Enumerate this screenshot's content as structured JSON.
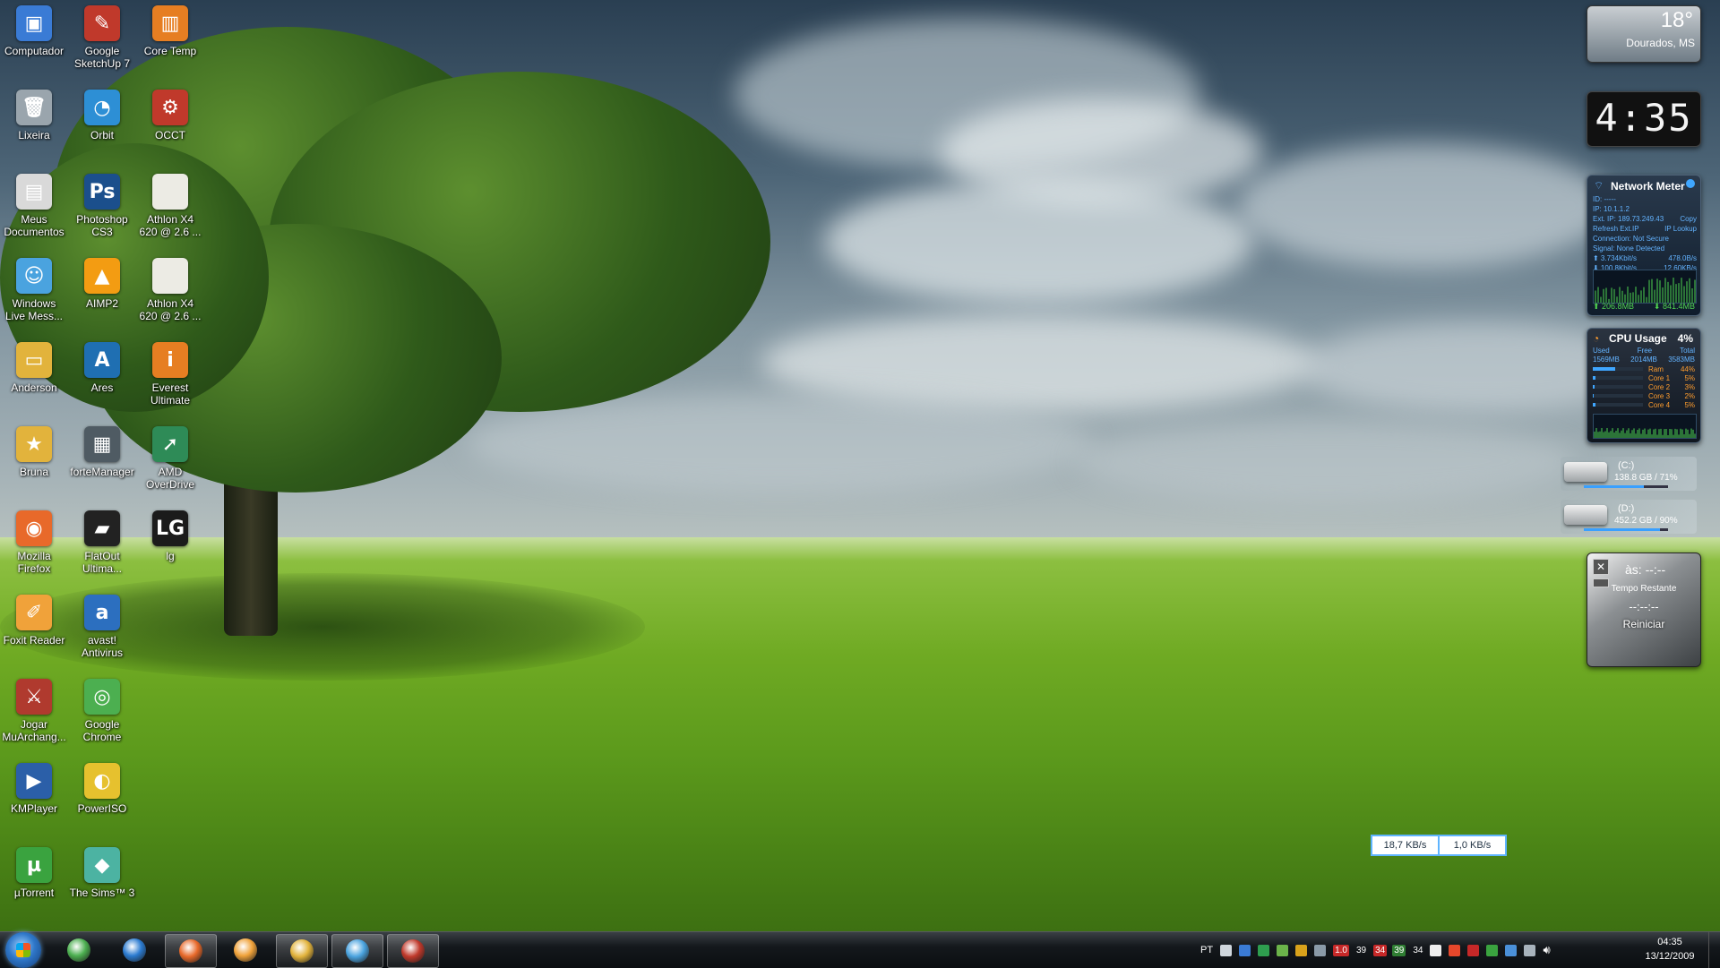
{
  "desktop": {
    "icons": [
      {
        "label": "Computador",
        "color": "#3a7bd5",
        "glyph": "▣"
      },
      {
        "label": "Google\nSketchUp 7",
        "color": "#c0392b",
        "glyph": "✎"
      },
      {
        "label": "Core Temp",
        "color": "#e67e22",
        "glyph": "▥"
      },
      {
        "label": "Lixeira",
        "color": "#9aa5ad",
        "glyph": "🗑"
      },
      {
        "label": "Orbit",
        "color": "#2d8fd5",
        "glyph": "◔"
      },
      {
        "label": "OCCT",
        "color": "#c0392b",
        "glyph": "⚙"
      },
      {
        "label": "Meus\nDocumentos",
        "color": "#d9d9d9",
        "glyph": "▤"
      },
      {
        "label": "Photoshop\nCS3",
        "color": "#1b4f8c",
        "glyph": "Ps"
      },
      {
        "label": "Athlon X4\n620 @ 2.6 ...",
        "color": "#ecebe4",
        "glyph": ""
      },
      {
        "label": "Windows\nLive Mess...",
        "color": "#4aa3df",
        "glyph": "☺"
      },
      {
        "label": "AIMP2",
        "color": "#f39c12",
        "glyph": "▲"
      },
      {
        "label": "Athlon X4\n620 @ 2.6 ...",
        "color": "#ecebe4",
        "glyph": ""
      },
      {
        "label": "Anderson",
        "color": "#e2b33c",
        "glyph": "▭"
      },
      {
        "label": "Ares",
        "color": "#1f6fb2",
        "glyph": "A"
      },
      {
        "label": "Everest\nUltimate",
        "color": "#e67e22",
        "glyph": "i"
      },
      {
        "label": "Bruna",
        "color": "#e2b33c",
        "glyph": "★"
      },
      {
        "label": "forteManager",
        "color": "#4f5b63",
        "glyph": "▦"
      },
      {
        "label": "AMD\nOverDrive",
        "color": "#2e8b57",
        "glyph": "➚"
      },
      {
        "label": "Mozilla\nFirefox",
        "color": "#e8692a",
        "glyph": "◉"
      },
      {
        "label": "FlatOut\nUltima...",
        "color": "#222222",
        "glyph": "▰"
      },
      {
        "label": "lg",
        "color": "#1b1b1b",
        "glyph": "LG"
      },
      {
        "label": "Foxit Reader",
        "color": "#f0a23a",
        "glyph": "✐"
      },
      {
        "label": "avast!\nAntivirus",
        "color": "#2c6fbf",
        "glyph": "a"
      },
      {
        "label": "Jogar\nMuArchang...",
        "color": "#b03a2e",
        "glyph": "⚔"
      },
      {
        "label": "Google\nChrome",
        "color": "#4caf50",
        "glyph": "◎"
      },
      {
        "label": "KMPlayer",
        "color": "#2b5fa8",
        "glyph": "▶"
      },
      {
        "label": "PowerISO",
        "color": "#e6c12e",
        "glyph": "◐"
      },
      {
        "label": "µTorrent",
        "color": "#3aa33f",
        "glyph": "µ"
      },
      {
        "label": "The Sims™ 3",
        "color": "#4cb3a2",
        "glyph": "◆"
      }
    ]
  },
  "gadgets": {
    "weather": {
      "temp": "18°",
      "city": "Dourados, MS"
    },
    "clock": {
      "time": "4:35"
    },
    "network_meter": {
      "title": "Network Meter",
      "rows": [
        {
          "l": "ID: -----",
          "r": ""
        },
        {
          "l": "IP: 10.1.1.2",
          "r": ""
        },
        {
          "l": "Ext. IP: 189.73.249.43",
          "r": "Copy"
        },
        {
          "l": "Refresh Ext.IP",
          "r": "IP Lookup"
        },
        {
          "l": "Connection: Not Secure",
          "r": ""
        },
        {
          "l": "Signal: None Detected",
          "r": ""
        },
        {
          "l": "⬆ 3.734Kbit/s",
          "r": "478.0B/s"
        },
        {
          "l": "⬇ 100.8Kbit/s",
          "r": "12.60KB/s"
        }
      ],
      "up_total": "⬆ 206.8MB",
      "down_total": "⬇ 841.4MB"
    },
    "cpu": {
      "title": "CPU Usage",
      "percent": "4%",
      "headers": [
        "Used",
        "Free",
        "Total"
      ],
      "values": [
        "1569MB",
        "2014MB",
        "3583MB"
      ],
      "bars": [
        {
          "name": "Ram",
          "value": "44%",
          "fill": 0.44
        },
        {
          "name": "Core 1",
          "value": "5%",
          "fill": 0.05
        },
        {
          "name": "Core 2",
          "value": "3%",
          "fill": 0.03
        },
        {
          "name": "Core 3",
          "value": "2%",
          "fill": 0.02
        },
        {
          "name": "Core 4",
          "value": "5%",
          "fill": 0.05
        }
      ]
    },
    "drives": [
      {
        "name": "(C:)",
        "info": "138.8 GB / 71%",
        "fill": 0.71
      },
      {
        "name": "(D:)",
        "info": "452.2 GB / 90%",
        "fill": 0.9
      }
    ],
    "shutdown": {
      "at": "às:   --:--",
      "remaining_label": "Tempo Restante",
      "remaining": "--:--:--",
      "action": "Reiniciar"
    }
  },
  "speed_meter": {
    "down": "18,7 KB/s",
    "up": "1,0 KB/s"
  },
  "taskbar": {
    "buttons": [
      {
        "name": "chrome",
        "color": "#4caf50",
        "active": false
      },
      {
        "name": "internet-explorer",
        "color": "#2b7bd1",
        "active": false
      },
      {
        "name": "firefox",
        "color": "#e8692a",
        "active": true
      },
      {
        "name": "media-player",
        "color": "#f0a23a",
        "active": false
      },
      {
        "name": "explorer",
        "color": "#e2b33c",
        "active": true
      },
      {
        "name": "messenger",
        "color": "#4aa3df",
        "active": true
      },
      {
        "name": "sketchup",
        "color": "#c0392b",
        "active": true
      }
    ],
    "tray": {
      "language": "PT",
      "numbers": [
        {
          "text": "1.0",
          "color": "#c62828"
        },
        {
          "text": "39",
          "color": "transparent"
        },
        {
          "text": "34",
          "color": "#c62828"
        },
        {
          "text": "39",
          "color": "#2e7d32"
        },
        {
          "text": "34",
          "color": "transparent"
        }
      ],
      "time": "04:35",
      "date": "13/12/2009"
    }
  }
}
